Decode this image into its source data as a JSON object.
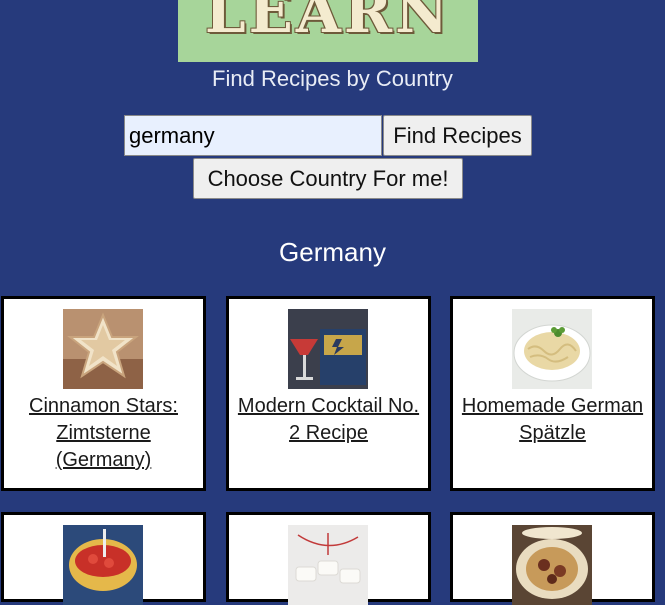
{
  "header": {
    "logo_text": "LEARN",
    "subtitle": "Find Recipes by Country"
  },
  "search": {
    "value": "germany",
    "find_label": "Find Recipes",
    "choose_label": "Choose Country For me!"
  },
  "results": {
    "country": "Germany",
    "recipes": [
      {
        "title": "Cinnamon Stars: Zimtsterne (Germany)",
        "image": "star-cookie-image"
      },
      {
        "title": "Modern Cocktail No. 2 Recipe",
        "image": "cocktail-glass-image"
      },
      {
        "title": "Homemade German Spätzle",
        "image": "spaetzle-plate-image"
      },
      {
        "title": "",
        "image": "red-dessert-cup-image"
      },
      {
        "title": "",
        "image": "white-cookies-twine-image"
      },
      {
        "title": "",
        "image": "tart-dish-image"
      }
    ]
  },
  "colors": {
    "background": "#263a7c",
    "logo_bg": "#a7d59a",
    "card_bg": "#ffffff"
  }
}
